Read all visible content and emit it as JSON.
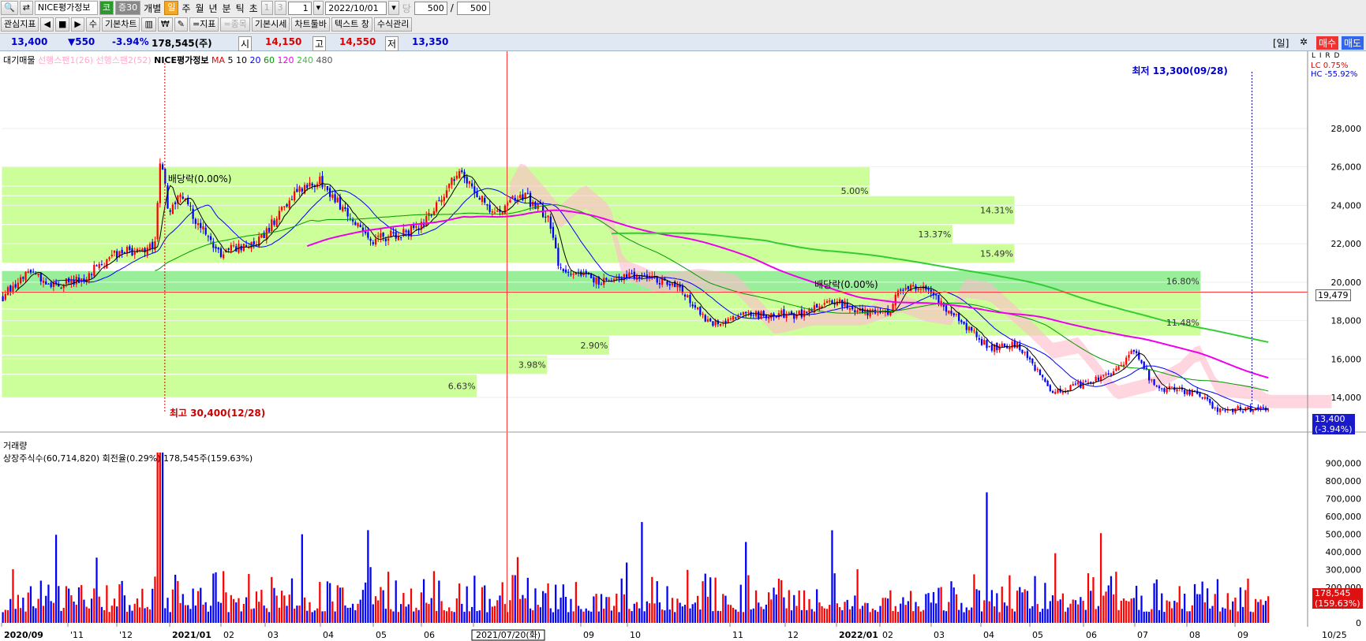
{
  "toolbar1": {
    "stock_name": "NICE평가정보",
    "market_badge": "코",
    "margin_badge": "증30",
    "indiv_label": "개별",
    "periods": [
      "일",
      "주",
      "월",
      "년",
      "분",
      "틱",
      "초"
    ],
    "num1": "1",
    "num2": "3",
    "unit_value": "1",
    "date": "2022/10/01",
    "count_label": "당",
    "count": "500",
    "slash": "/",
    "total": "500"
  },
  "toolbar2": {
    "items": [
      "관심지표",
      "기본차트",
      "₩",
      "=지표",
      "=종목",
      "기본시세",
      "차트툴바",
      "텍스트 창",
      "수식관리"
    ],
    "nav": [
      "◀",
      "■",
      "▶",
      "수"
    ]
  },
  "quote": {
    "price": "13,400",
    "change": "▼550",
    "rate": "-3.94%",
    "volume": "178,545(주)",
    "open_label": "시",
    "open": "14,150",
    "high_label": "고",
    "high": "14,550",
    "low_label": "저",
    "low": "13,350",
    "period_label": "[일]",
    "buy_label": "매수",
    "sell_label": "매도"
  },
  "legend": {
    "main": "대기매물",
    "span1": "선행스팬1(26)",
    "span2": "선행스팬2(52)",
    "name": "NICE평가정보",
    "ma_label": "MA",
    "ma_periods": [
      "5",
      "10",
      "20",
      "60",
      "120",
      "240",
      "480"
    ],
    "ma_colors": [
      "#000000",
      "#000000",
      "#0000ff",
      "#009900",
      "#ff00ff",
      "#33cc33",
      "#555555"
    ]
  },
  "right_panel": {
    "lc": "LC  0.75%",
    "hc": "HC -55.92%",
    "lird": "L I R D",
    "price_tag": "19,479",
    "last_tag": "13,400",
    "last_rate": "(-3.94%)",
    "vol_tag": "178,545",
    "vol_rate": "(159.63%)"
  },
  "volume_legend": {
    "title": "거래량",
    "info": "상장주식수(60,714,820) 회전율(0.29%) 178,545주(159.63%)"
  },
  "colors": {
    "up": "#ff0000",
    "down": "#0000ff",
    "band": "#ccff99",
    "band_hl": "#99ee99",
    "cloud": "#ffbbcc",
    "ma120": "#ee00ee",
    "ma240": "#33cc33"
  },
  "chart_data": {
    "type": "candlestick",
    "ylim": [
      12400,
      31200
    ],
    "y_ticks": [
      14000,
      16000,
      18000,
      20000,
      22000,
      24000,
      26000,
      28000
    ],
    "volume_ylim": [
      0,
      1000000
    ],
    "volume_ticks": [
      0,
      100000,
      200000,
      300000,
      400000,
      500000,
      600000,
      700000,
      800000,
      900000
    ],
    "x_ticks": [
      {
        "label": "2020/09",
        "bold": true
      },
      {
        "label": "'11"
      },
      {
        "label": "'12"
      },
      {
        "label": "2021/01",
        "bold": true
      },
      {
        "label": "02"
      },
      {
        "label": "03"
      },
      {
        "label": "04"
      },
      {
        "label": "05"
      },
      {
        "label": "06"
      },
      {
        "label": "2021/07/20(화)",
        "box": true
      },
      {
        "label": "09"
      },
      {
        "label": "10"
      },
      {
        "label": "11"
      },
      {
        "label": "12"
      },
      {
        "label": "2022/01",
        "bold": true
      },
      {
        "label": "02"
      },
      {
        "label": "03"
      },
      {
        "label": "04"
      },
      {
        "label": "05"
      },
      {
        "label": "06"
      },
      {
        "label": "07"
      },
      {
        "label": "08"
      },
      {
        "label": "09"
      },
      {
        "label": "10"
      }
    ],
    "x_right_label": "10/25",
    "price_anchors": [
      [
        0,
        19200
      ],
      [
        0.02,
        20700
      ],
      [
        0.04,
        19800
      ],
      [
        0.06,
        20100
      ],
      [
        0.09,
        21500
      ],
      [
        0.12,
        21800
      ],
      [
        0.125,
        26800
      ],
      [
        0.13,
        23800
      ],
      [
        0.14,
        24500
      ],
      [
        0.17,
        21500
      ],
      [
        0.2,
        22000
      ],
      [
        0.23,
        24500
      ],
      [
        0.25,
        25300
      ],
      [
        0.27,
        23800
      ],
      [
        0.29,
        22200
      ],
      [
        0.33,
        22800
      ],
      [
        0.35,
        24600
      ],
      [
        0.36,
        25800
      ],
      [
        0.38,
        24300
      ],
      [
        0.39,
        23500
      ],
      [
        0.41,
        24600
      ],
      [
        0.43,
        23500
      ],
      [
        0.44,
        20800
      ],
      [
        0.47,
        20000
      ],
      [
        0.5,
        20300
      ],
      [
        0.53,
        20000
      ],
      [
        0.56,
        17800
      ],
      [
        0.59,
        18300
      ],
      [
        0.63,
        18300
      ],
      [
        0.66,
        19000
      ],
      [
        0.68,
        18500
      ],
      [
        0.7,
        18300
      ],
      [
        0.71,
        19800
      ],
      [
        0.73,
        19600
      ],
      [
        0.76,
        17800
      ],
      [
        0.78,
        16500
      ],
      [
        0.8,
        16800
      ],
      [
        0.83,
        14300
      ],
      [
        0.86,
        14800
      ],
      [
        0.88,
        15500
      ],
      [
        0.895,
        16500
      ],
      [
        0.91,
        14500
      ],
      [
        0.94,
        14300
      ],
      [
        0.96,
        13400
      ]
    ],
    "bands": [
      {
        "from": 0,
        "to": 21000,
        "y": [
          25000,
          26000
        ],
        "label": ""
      },
      {
        "from": 0,
        "to": 21000,
        "y": [
          24500,
          25000
        ],
        "label": "5.00%"
      },
      {
        "from": 0,
        "to": 24500,
        "y": [
          23000,
          24500
        ],
        "label": "14.31%"
      },
      {
        "from": 0,
        "to": 23000,
        "y": [
          22000,
          23000
        ],
        "label": "13.37%"
      },
      {
        "from": 0,
        "to": 24500,
        "y": [
          21000,
          22000
        ],
        "label": "15.49%"
      },
      {
        "from": 0,
        "to": 29000,
        "y": [
          19500,
          20600
        ],
        "label": "16.80%",
        "highlight": true
      },
      {
        "from": 0,
        "to": 29000,
        "y": [
          18600,
          19500
        ],
        "label": ""
      },
      {
        "from": 0,
        "to": 29000,
        "y": [
          17200,
          18600
        ],
        "label": "11.48%"
      },
      {
        "from": 0,
        "to": 14700,
        "y": [
          16200,
          17200
        ],
        "label": "2.90%"
      },
      {
        "from": 0,
        "to": 13200,
        "y": [
          15200,
          16200
        ],
        "label": "3.98%"
      },
      {
        "from": 0,
        "to": 11500,
        "y": [
          14000,
          15200
        ],
        "label": "6.63%"
      }
    ],
    "annotations": [
      {
        "text": "배당락(0.00%)",
        "x": 0.125,
        "y": 25200
      },
      {
        "text": "배당락(0.00%)",
        "x": 0.62,
        "y": 19700
      },
      {
        "text": "최고 30,400(12/28)",
        "x": 0.125,
        "y": 30400
      },
      {
        "text": "최저 13,300(09/28)",
        "x": 0.955,
        "y": 13300
      }
    ],
    "hline": 19479,
    "crosshair_x": 0.387
  }
}
